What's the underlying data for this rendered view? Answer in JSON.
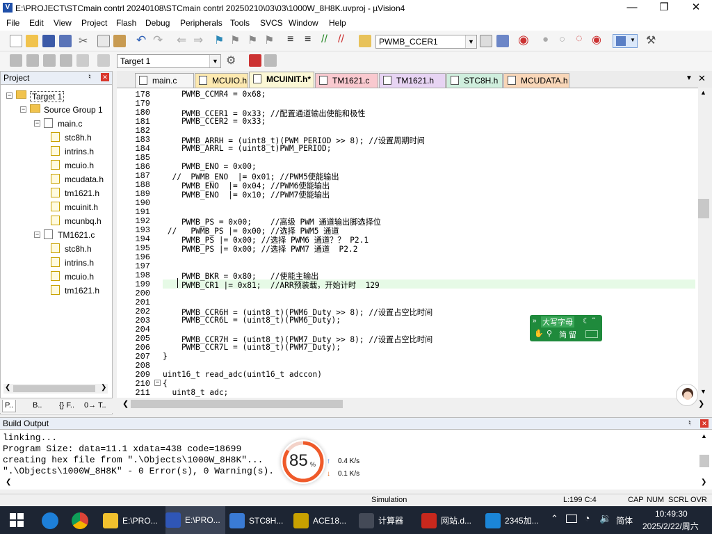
{
  "window": {
    "title": "E:\\PROJECT\\STCmain contrl 20240108\\STCmain contrl 20250210\\03\\03\\1000W_8H8K.uvproj - µVision4"
  },
  "menu": [
    "File",
    "Edit",
    "View",
    "Project",
    "Flash",
    "Debug",
    "Peripherals",
    "Tools",
    "SVCS",
    "Window",
    "Help"
  ],
  "toolbar": {
    "find_value": "PWMB_CCER1",
    "target_value": "Target 1"
  },
  "project": {
    "header": "Project",
    "tree": [
      {
        "label": "Target 1",
        "level": 0,
        "kind": "target"
      },
      {
        "label": "Source Group 1",
        "level": 1,
        "kind": "folder"
      },
      {
        "label": "main.c",
        "level": 2,
        "kind": "c"
      },
      {
        "label": "stc8h.h",
        "level": 3,
        "kind": "h"
      },
      {
        "label": "intrins.h",
        "level": 3,
        "kind": "h"
      },
      {
        "label": "mcuio.h",
        "level": 3,
        "kind": "h"
      },
      {
        "label": "mcudata.h",
        "level": 3,
        "kind": "h"
      },
      {
        "label": "tm1621.h",
        "level": 3,
        "kind": "h"
      },
      {
        "label": "mcuinit.h",
        "level": 3,
        "kind": "h"
      },
      {
        "label": "mcunbq.h",
        "level": 3,
        "kind": "h"
      },
      {
        "label": "TM1621.c",
        "level": 2,
        "kind": "c"
      },
      {
        "label": "stc8h.h",
        "level": 3,
        "kind": "h"
      },
      {
        "label": "intrins.h",
        "level": 3,
        "kind": "h"
      },
      {
        "label": "mcuio.h",
        "level": 3,
        "kind": "h"
      },
      {
        "label": "tm1621.h",
        "level": 3,
        "kind": "h"
      }
    ],
    "bottom_tabs": [
      "P..",
      "B..",
      "{} F..",
      "0→ T.."
    ]
  },
  "tabs": [
    {
      "label": "main.c",
      "color": "#f5f5f5"
    },
    {
      "label": "MCUIO.h",
      "color": "#fde9b0"
    },
    {
      "label": "MCUINIT.h*",
      "color": "#f7f2c8"
    },
    {
      "label": "TM1621.c",
      "color": "#f9c9cf"
    },
    {
      "label": "TM1621.h",
      "color": "#e7d4f3"
    },
    {
      "label": "STC8H.h",
      "color": "#cfeedd"
    },
    {
      "label": "MCUDATA.h",
      "color": "#f8d6b8"
    }
  ],
  "code": [
    {
      "n": "178",
      "t": "    PWMB_CCMR4 = 0x68;"
    },
    {
      "n": "179",
      "t": ""
    },
    {
      "n": "180",
      "t": "    PWMB_CCER1 = 0x33; //配置通道输出使能和极性"
    },
    {
      "n": "181",
      "t": "    PWMB_CCER2 = 0x33;"
    },
    {
      "n": "182",
      "t": ""
    },
    {
      "n": "183",
      "t": "    PWMB_ARRH = (uint8_t)(PWM_PERIOD >> 8); //设置周期时间"
    },
    {
      "n": "184",
      "t": "    PWMB_ARRL = (uint8_t)PWM_PERIOD;"
    },
    {
      "n": "185",
      "t": ""
    },
    {
      "n": "186",
      "t": "    PWMB_ENO = 0x00;"
    },
    {
      "n": "187",
      "t": "  //  PWMB_ENO  |= 0x01; //PWM5使能输出"
    },
    {
      "n": "188",
      "t": "    PWMB_ENO  |= 0x04; //PWM6使能输出"
    },
    {
      "n": "189",
      "t": "    PWMB_ENO  |= 0x10; //PWM7使能输出"
    },
    {
      "n": "190",
      "t": ""
    },
    {
      "n": "191",
      "t": ""
    },
    {
      "n": "192",
      "t": "    PWMB_PS = 0x00;    //高级 PWM 通道输出脚选择位"
    },
    {
      "n": "193",
      "t": " //   PWMB_PS |= 0x00; //选择 PWM5 通道"
    },
    {
      "n": "194",
      "t": "    PWMB_PS |= 0x00; //选择 PWM6 通道？？ P2.1"
    },
    {
      "n": "195",
      "t": "    PWMB_PS |= 0x00; //选择 PWM7 通道  P2.2"
    },
    {
      "n": "196",
      "t": ""
    },
    {
      "n": "197",
      "t": ""
    },
    {
      "n": "198",
      "t": "    PWMB_BKR = 0x80;   //使能主输出"
    },
    {
      "n": "199",
      "t": "    PWMB_CR1 |= 0x81;  //ARR预装载，开始计时  129"
    },
    {
      "n": "200",
      "t": ""
    },
    {
      "n": "201",
      "t": ""
    },
    {
      "n": "202",
      "t": "    PWMB_CCR6H = (uint8_t)(PWM6_Duty >> 8); //设置占空比时间"
    },
    {
      "n": "203",
      "t": "    PWMB_CCR6L = (uint8_t)(PWM6_Duty);"
    },
    {
      "n": "204",
      "t": ""
    },
    {
      "n": "205",
      "t": "    PWMB_CCR7H = (uint8_t)(PWM7_Duty >> 8); //设置占空比时间"
    },
    {
      "n": "206",
      "t": "    PWMB_CCR7L = (uint8_t)(PWM7_Duty);"
    },
    {
      "n": "207",
      "t": "}"
    },
    {
      "n": "208",
      "t": ""
    },
    {
      "n": "209",
      "t": "uint16_t read_adc(uint16_t adccon)"
    },
    {
      "n": "210",
      "t": "{"
    },
    {
      "n": "211",
      "t": "  uint8_t adc;"
    }
  ],
  "build": {
    "header": "Build Output",
    "lines": [
      "linking...",
      "Program Size: data=11.1 xdata=438 code=18699",
      "creating hex file from \".\\Objects\\1000W_8H8K\"...",
      "\".\\Objects\\1000W_8H8K\" - 0 Error(s), 0 Warning(s)."
    ]
  },
  "status": {
    "mode": "Simulation",
    "pos": "L:199 C:4",
    "caps": "CAP",
    "num": "NUM",
    "scrl": "SCRL",
    "ovr": "OVR"
  },
  "widget": {
    "percent": "85",
    "percent_sign": "%",
    "up": "0.4 K/s",
    "down": "0.1 K/s"
  },
  "ime": {
    "row1": "大写字母",
    "row2": "简 留"
  },
  "taskbar": {
    "items": [
      {
        "label": "E:\\PRO...",
        "color": "#f2c12e"
      },
      {
        "label": "E:\\PRO...",
        "color": "#2f56b6"
      },
      {
        "label": "STC8H...",
        "color": "#3a7bd5"
      },
      {
        "label": "ACE18...",
        "color": "#c8a100"
      },
      {
        "label": "计算器",
        "color": "#444a57"
      },
      {
        "label": "网站.d...",
        "color": "#c8281d"
      },
      {
        "label": "2345加...",
        "color": "#1b86d8"
      }
    ],
    "ime_lang": "简体",
    "time": "10:49:30",
    "date": "2025/2/22/周六"
  }
}
